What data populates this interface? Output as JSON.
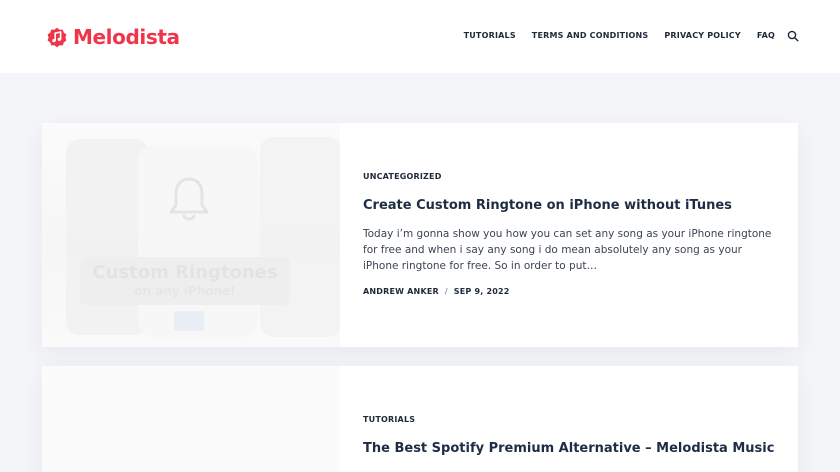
{
  "brand": {
    "name": "Melodista",
    "color": "#f0354b"
  },
  "nav": {
    "items": [
      {
        "label": "TUTORIALS"
      },
      {
        "label": "TERMS AND CONDITIONS"
      },
      {
        "label": "PRIVACY POLICY"
      },
      {
        "label": "FAQ"
      }
    ],
    "search_icon": "search-icon"
  },
  "posts": [
    {
      "category": "UNCATEGORIZED",
      "title": "Create Custom Ringtone on iPhone without iTunes",
      "excerpt": "Today i’m gonna show you how you can set any song as your iPhone ringtone for free and when i say any song i do mean absolutely any song as your iPhone ringtone for free. So in order to put…",
      "author": "ANDREW ANKER",
      "separator": "/",
      "date": "SEP 9, 2022",
      "thumbnail": {
        "heading": "Custom Ringtones",
        "subheading": "on any iPhone!",
        "icon": "bell-icon"
      }
    },
    {
      "category": "TUTORIALS",
      "title": "The Best Spotify Premium Alternative – Melodista Music"
    }
  ]
}
